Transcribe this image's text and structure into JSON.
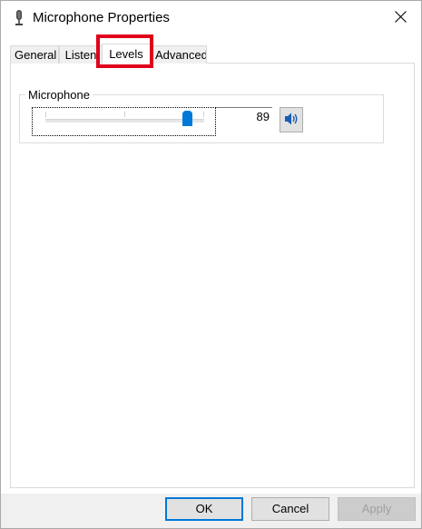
{
  "window": {
    "title": "Microphone Properties",
    "icon": "microphone-icon"
  },
  "tabs": [
    {
      "label": "General"
    },
    {
      "label": "Listen"
    },
    {
      "label": "Levels"
    },
    {
      "label": "Advanced"
    }
  ],
  "active_tab": "Levels",
  "levels": {
    "group_label": "Microphone",
    "level_value": "89",
    "slider_fraction": 0.89,
    "speaker_icon": "speaker-icon"
  },
  "footer": {
    "ok_label": "OK",
    "cancel_label": "Cancel",
    "apply_label": "Apply"
  },
  "colors": {
    "accent": "#0078d7",
    "highlight": "#e0001c"
  }
}
